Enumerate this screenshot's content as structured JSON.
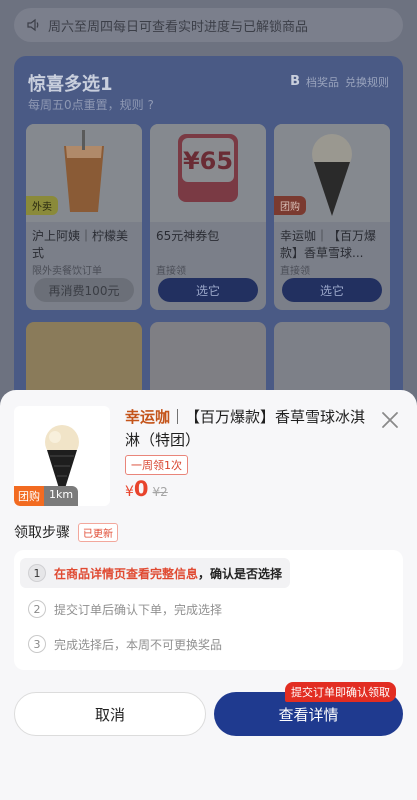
{
  "notice": {
    "text": "周六至周四每日可查看实时进度与已解锁商品"
  },
  "panel": {
    "title": "惊喜多选1",
    "subtitle": "每周五0点重置，规则 ?",
    "right_b": "B",
    "right_label": "档奖品",
    "right_extra": "兑换规则"
  },
  "cards": [
    {
      "tag": "外卖",
      "name": "沪上阿姨｜柠檬美式",
      "hint": "限外卖餐饮订单",
      "button": "再消费100元"
    },
    {
      "tag": "",
      "name": "65元神券包",
      "hint": "直接领",
      "button": "选它"
    },
    {
      "tag": "团购",
      "name": "幸运咖｜【百万爆款】香草雪球...",
      "hint": "直接领",
      "button": "选它"
    }
  ],
  "sheet": {
    "badge_a": "团购",
    "badge_b": "1km",
    "brand": "幸运咖",
    "title_rest": "｜【百万爆款】香草雪球冰淇淋（特团）",
    "limit": "一周领1次",
    "price_symbol": "¥",
    "price_value": "0",
    "price_original": "¥2",
    "steps_title": "领取步骤",
    "updated": "已更新",
    "steps": [
      {
        "num": "1",
        "red": "在商品详情页查看完整信息",
        "black": "，确认是否选择"
      },
      {
        "num": "2",
        "text": "提交订单后确认下单，完成选择"
      },
      {
        "num": "3",
        "text": "完成选择后，本周不可更换奖品"
      }
    ],
    "cancel": "取消",
    "detail": "查看详情",
    "ribbon": "提交订单即确认领取"
  },
  "colors": {
    "accent": "#1f3a8f",
    "price_red": "#e8442c",
    "brand_orange": "#c4541a"
  }
}
